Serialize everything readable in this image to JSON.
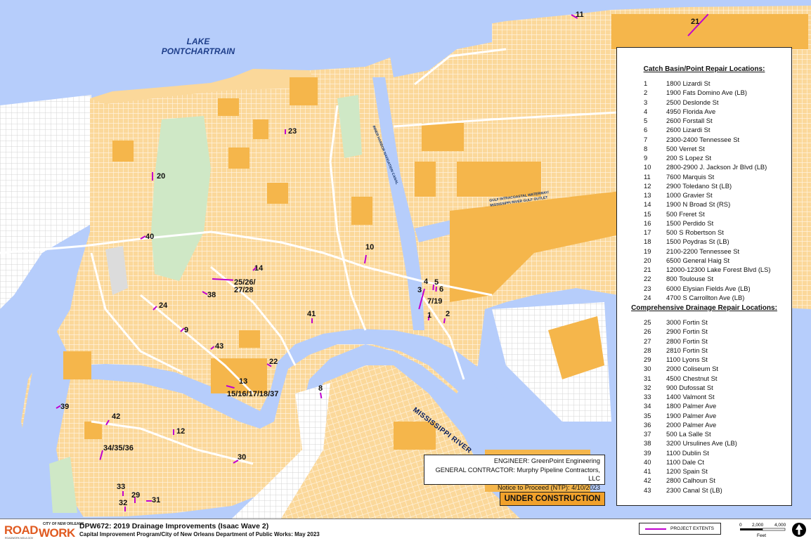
{
  "map": {
    "lake_label": "LAKE\nPONTCHARTRAIN",
    "river_label": "MISSISSIPPI RIVER",
    "canal_label": "INNER HARBOR NAVIGATION CANAL",
    "gulf_label_line1": "GULF INTRACOASTAL WATERWAY/",
    "gulf_label_line2": "MISSISSIPPI RIVER GULF OUTLET",
    "project_labels": [
      {
        "text": "1"
      },
      {
        "text": "2"
      },
      {
        "text": "3"
      },
      {
        "text": "4"
      },
      {
        "text": "5"
      },
      {
        "text": "6"
      },
      {
        "text": "7/19"
      },
      {
        "text": "8"
      },
      {
        "text": "9"
      },
      {
        "text": "10"
      },
      {
        "text": "11"
      },
      {
        "text": "12"
      },
      {
        "text": "13"
      },
      {
        "text": "14"
      },
      {
        "text": "15/16/17/18/37"
      },
      {
        "text": "20"
      },
      {
        "text": "21"
      },
      {
        "text": "22"
      },
      {
        "text": "23"
      },
      {
        "text": "24"
      },
      {
        "text": "25/26/"
      },
      {
        "text": "27/28"
      },
      {
        "text": "29"
      },
      {
        "text": "30"
      },
      {
        "text": "31"
      },
      {
        "text": "32"
      },
      {
        "text": "33"
      },
      {
        "text": "34/35/36"
      },
      {
        "text": "38"
      },
      {
        "text": "39"
      },
      {
        "text": "40"
      },
      {
        "text": "41"
      },
      {
        "text": "42"
      },
      {
        "text": "43"
      }
    ]
  },
  "legend": {
    "catch_basin_heading": "Catch Basin/Point Repair Locations:",
    "catch_basin_items": [
      {
        "num": "1",
        "addr": "1800 Lizardi St"
      },
      {
        "num": "2",
        "addr": "1900 Fats Domino Ave (LB)"
      },
      {
        "num": "3",
        "addr": "2500 Deslonde St"
      },
      {
        "num": "4",
        "addr": "4950 Florida Ave"
      },
      {
        "num": "5",
        "addr": "2600 Forstall St"
      },
      {
        "num": "6",
        "addr": "2600 Lizardi St"
      },
      {
        "num": "7",
        "addr": "2300-2400 Tennessee St"
      },
      {
        "num": "8",
        "addr": "500 Verret St"
      },
      {
        "num": "9",
        "addr": "200 S Lopez St"
      },
      {
        "num": "10",
        "addr": "2800-2900 J. Jackson Jr Blvd  (LB)"
      },
      {
        "num": "11",
        "addr": "7600 Marquis St"
      },
      {
        "num": "12",
        "addr": "2900 Toledano St (LB)"
      },
      {
        "num": "13",
        "addr": "1000 Gravier St"
      },
      {
        "num": "14",
        "addr": "1900 N Broad St (RS)"
      },
      {
        "num": "15",
        "addr": "500 Freret St"
      },
      {
        "num": "16",
        "addr": "1500 Perdido St"
      },
      {
        "num": "17",
        "addr": "500 S Robertson St"
      },
      {
        "num": "18",
        "addr": "1500 Poydras St (LB)"
      },
      {
        "num": "19",
        "addr": "2100-2200 Tennessee St"
      },
      {
        "num": "20",
        "addr": "6500 General Haig St"
      },
      {
        "num": "21",
        "addr": "12000-12300 Lake Forest Blvd (LS)"
      },
      {
        "num": "22",
        "addr": "800 Toulouse St"
      },
      {
        "num": "23",
        "addr": "6000 Elysian Fields Ave (LB)"
      },
      {
        "num": "24",
        "addr": "4700 S Carrollton Ave (LB)"
      }
    ],
    "drainage_heading": "Comprehensive Drainage Repair Locations:",
    "drainage_items": [
      {
        "num": "25",
        "addr": "3000 Fortin St"
      },
      {
        "num": "26",
        "addr": "2900 Fortin St"
      },
      {
        "num": "27",
        "addr": "2800 Fortin St"
      },
      {
        "num": "28",
        "addr": "2810 Fortin St"
      },
      {
        "num": "29",
        "addr": "1100 Lyons St"
      },
      {
        "num": "30",
        "addr": "2000 Coliseum St"
      },
      {
        "num": "31",
        "addr": "4500 Chestnut St"
      },
      {
        "num": "32",
        "addr": "900 Dufossat St"
      },
      {
        "num": "33",
        "addr": "1400 Valmont St"
      },
      {
        "num": "34",
        "addr": "1800 Palmer Ave"
      },
      {
        "num": "35",
        "addr": "1900 Palmer Ave"
      },
      {
        "num": "36",
        "addr": "2000 Palmer Ave"
      },
      {
        "num": "37",
        "addr": "500 La Salle St"
      },
      {
        "num": "38",
        "addr": "3200 Ursulines Ave (LB)"
      },
      {
        "num": "39",
        "addr": "1100 Dublin St"
      },
      {
        "num": "40",
        "addr": "1100 Dale Ct"
      },
      {
        "num": "41",
        "addr": "1200 Spain St"
      },
      {
        "num": "42",
        "addr": "2800 Calhoun St"
      },
      {
        "num": "43",
        "addr": "2300 Canal St (LB)"
      }
    ]
  },
  "info": {
    "engineer": "ENGINEER:  GreenPoint Engineering",
    "contractor": "GENERAL CONTRACTOR:  Murphy Pipeline Contractors, LLC",
    "ntp": "Notice to Proceed (NTP):  4/10/2023",
    "status": "UNDER CONSTRUCTION"
  },
  "footer": {
    "logo_road": "ROAD",
    "logo_work": "WORK",
    "logo_city": "CITY OF NEW ORLEANS",
    "logo_sub": "ROADWORK.NOLA.GOV",
    "title": "DPW672:  2019 Drainage Improvements (Isaac Wave 2)",
    "subtitle": "Capital Improvement Program/City of New Orleans Department of Public Works:  May 2023",
    "legend_project_extents": "PROJECT EXTENTS",
    "scale_0": "0",
    "scale_2000": "2,000",
    "scale_4000": "4,000",
    "scale_unit": "Feet"
  },
  "colors": {
    "water": "#b6cdfb",
    "land": "#fbd89a",
    "grid": "#fff5e2",
    "industrial": "#f5b64b",
    "park": "#cfe8c6",
    "project": "#c000d0",
    "status": "#f1a12b",
    "logo": "#e05a20"
  }
}
